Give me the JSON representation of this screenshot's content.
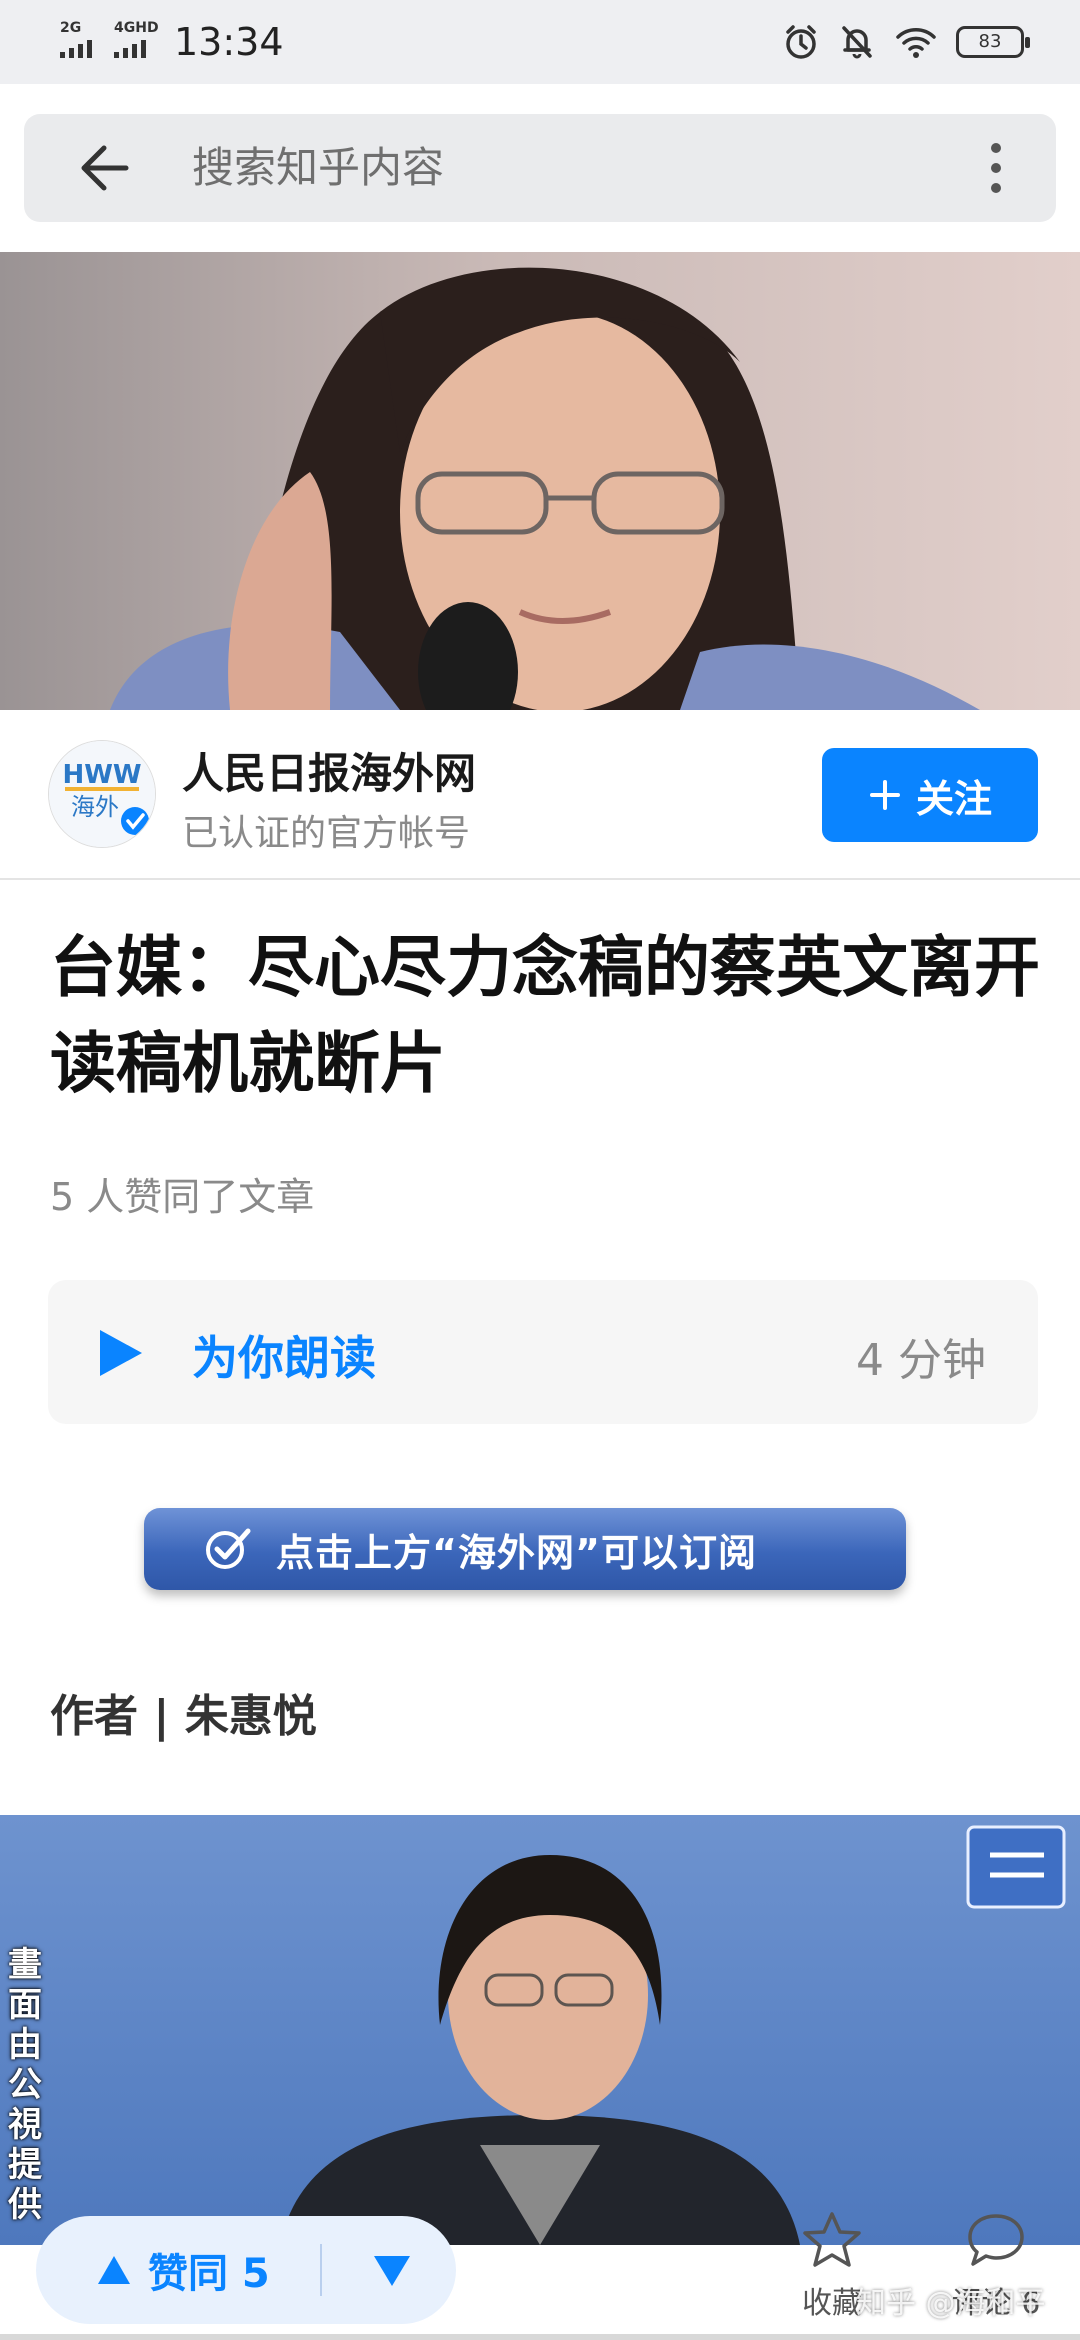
{
  "status_bar": {
    "signal_1": "2G",
    "signal_2": "4GHD",
    "time": "13:34",
    "battery": "83"
  },
  "search": {
    "placeholder": "搜索知乎内容"
  },
  "author": {
    "name": "人民日报海外网",
    "subtitle": "已认证的官方帐号",
    "follow_label": "关注",
    "avatar_text": "HWW"
  },
  "article": {
    "title": "台媒：尽心尽力念稿的蔡英文离开读稿机就断片",
    "likes_text": "5 人赞同了文章",
    "read_label": "为你朗读",
    "read_time": "4 分钟",
    "subscribe_banner": "点击上方“海外网”可以订阅",
    "byline": "作者 | 朱惠悦",
    "photo_caption": "畫面由公視提供"
  },
  "bottom_bar": {
    "upvote_label": "赞同 5",
    "collect_label": "收藏",
    "comment_label": "评论 6",
    "watermark": "知乎 @海和平"
  },
  "colors": {
    "accent": "#0a84ff",
    "banner": "#3b66ba"
  },
  "icons": [
    "back-arrow-icon",
    "more-vertical-icon",
    "play-icon",
    "check-icon",
    "upvote-triangle-icon",
    "downvote-triangle-icon",
    "star-icon",
    "comment-bubble-icon"
  ]
}
